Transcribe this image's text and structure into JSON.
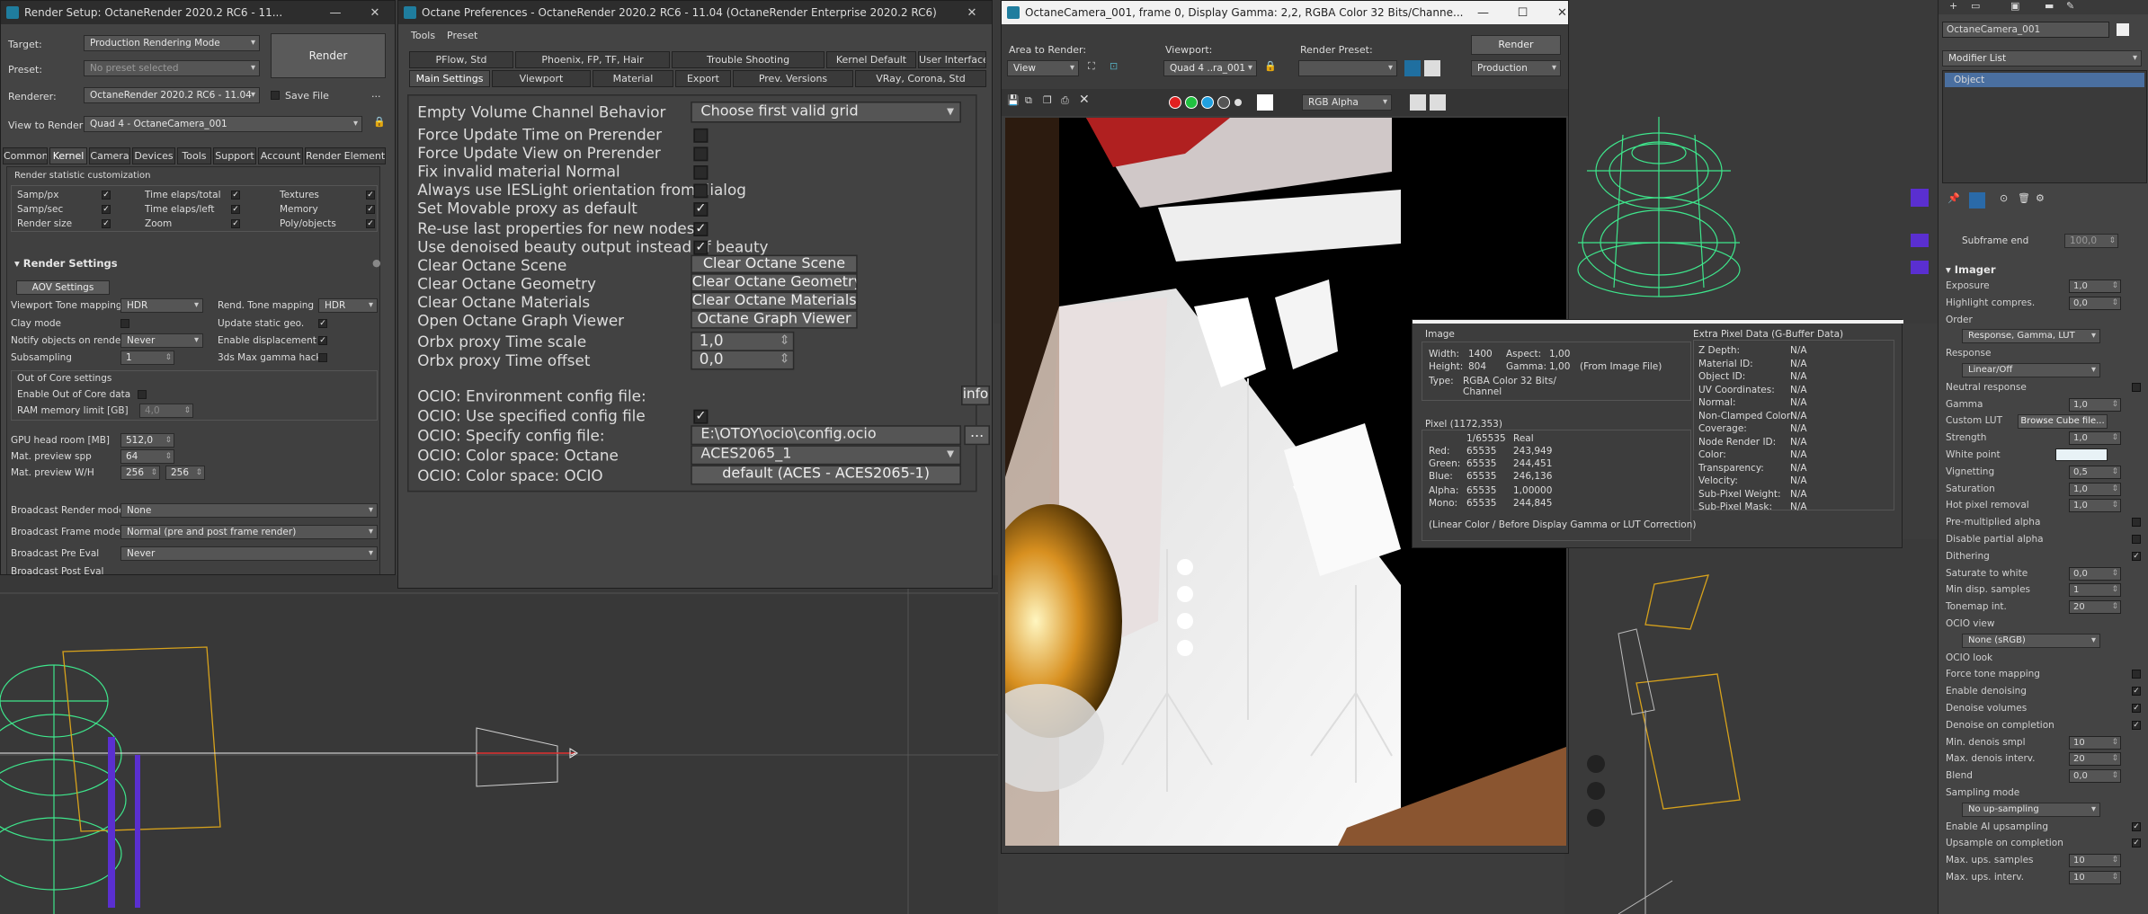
{
  "render_setup": {
    "title": "Render Setup: OctaneRender 2020.2 RC6 - 11...",
    "target_label": "Target:",
    "target_value": "Production Rendering Mode",
    "preset_label": "Preset:",
    "preset_value": "No preset selected",
    "renderer_label": "Renderer:",
    "renderer_value": "OctaneRender 2020.2 RC6 - 11.04",
    "save_file": "Save File",
    "view_label": "View to Render:",
    "view_value": "Quad 4 - OctaneCamera_001",
    "render_button": "Render",
    "tabs": [
      "Common",
      "Kernel",
      "Camera",
      "Devices",
      "Tools",
      "Support",
      "Account",
      "Render Elements"
    ],
    "stats_header": "Render statistic customization",
    "stats": [
      [
        "Samp/px",
        "Time elaps/total",
        "Textures"
      ],
      [
        "Samp/sec",
        "Time elaps/left",
        "Memory"
      ],
      [
        "Render size",
        "Zoom",
        "Poly/objects"
      ]
    ],
    "settings_header": "Render Settings",
    "aov_button": "AOV Settings",
    "vp_tone_label": "Viewport Tone mapping",
    "vp_tone_value": "HDR",
    "rend_tone_label": "Rend. Tone mapping",
    "rend_tone_value": "HDR",
    "clay_label": "Clay mode",
    "update_static_label": "Update static geo.",
    "notify_label": "Notify objects on render",
    "notify_value": "Never",
    "enable_disp_label": "Enable displacement",
    "subsampling_label": "Subsampling",
    "subsampling_value": "1",
    "gamma_hack_label": "3ds Max gamma hack",
    "out_of_core_header": "Out of Core settings",
    "enable_ooc_label": "Enable Out of Core data",
    "ram_limit_label": "RAM memory limit [GB]",
    "ram_limit_value": "4,0",
    "gpu_headroom_label": "GPU head room [MB]",
    "gpu_headroom_value": "512,0",
    "mat_spp_label": "Mat. preview spp",
    "mat_spp_value": "64",
    "mat_wh_label": "Mat. preview W/H",
    "mat_w_value": "256",
    "mat_h_value": "256",
    "bcast_render_label": "Broadcast Render mode",
    "bcast_render_value": "None",
    "bcast_frame_label": "Broadcast Frame mode",
    "bcast_frame_value": "Normal (pre and post frame render)",
    "bcast_pre_label": "Broadcast Pre Eval",
    "bcast_pre_value": "Never",
    "bcast_more_label": "Broadcast Post Eval"
  },
  "prefs": {
    "title": "Octane Preferences - OctaneRender 2020.2 RC6 - 11.04 (OctaneRender Enterprise 2020.2 RC6)",
    "menu": [
      "Tools",
      "Preset"
    ],
    "tabs_row1": [
      "PFlow, Std",
      "Phoenix, FP, TF, Hair",
      "Trouble Shooting",
      "Kernel Default",
      "User Interface"
    ],
    "tabs_row2": [
      "Main Settings",
      "Viewport",
      "Material",
      "Export",
      "Prev. Versions",
      "VRay, Corona, Std"
    ],
    "rows": [
      {
        "label": "Empty Volume Channel Behavior",
        "type": "drop",
        "value": "Choose first valid grid"
      },
      {
        "label": "Force Update Time on Prerender",
        "type": "chk",
        "value": ""
      },
      {
        "label": "Force Update View on Prerender",
        "type": "chk",
        "value": ""
      },
      {
        "label": "Fix invalid material Normal",
        "type": "chk",
        "value": ""
      },
      {
        "label": "Always use IESLight orientation from dialog",
        "type": "chk",
        "value": ""
      },
      {
        "label": "Set Movable proxy as default",
        "type": "chk",
        "value": "✓"
      },
      {
        "label": "Re-use last properties for new nodes",
        "type": "chk",
        "value": "✓"
      },
      {
        "label": "Use denoised beauty output instead of beauty",
        "type": "chk",
        "value": "✓"
      },
      {
        "label": "Clear Octane Scene",
        "type": "btn",
        "value": "Clear Octane Scene"
      },
      {
        "label": "Clear Octane Geometry",
        "type": "btn",
        "value": "Clear Octane Geometry"
      },
      {
        "label": "Clear Octane Materials",
        "type": "btn",
        "value": "Clear Octane Materials"
      },
      {
        "label": "Open Octane Graph Viewer",
        "type": "btn",
        "value": "Octane Graph Viewer"
      },
      {
        "label": "Orbx proxy Time scale",
        "type": "spin",
        "value": "1,0"
      },
      {
        "label": "Orbx proxy Time offset",
        "type": "spin",
        "value": "0,0"
      }
    ],
    "ocio_env_label": "OCIO: Environment config file:",
    "info_btn": "info",
    "ocio_use_label": "OCIO: Use specified config file",
    "ocio_spec_label": "OCIO: Specify config file:",
    "ocio_spec_value": "E:\\OTOY\\ocio\\config.ocio",
    "browse_btn": "...",
    "ocio_cs_octane_label": "OCIO: Color space: Octane",
    "ocio_cs_octane_value": "ACES2065_1",
    "ocio_cs_ocio_label": "OCIO: Color space: OCIO",
    "ocio_cs_ocio_value": "default (ACES - ACES2065-1)"
  },
  "camera_win": {
    "title": "OctaneCamera_001, frame 0, Display Gamma: 2,2, RGBA Color 32 Bits/Channe...",
    "area_label": "Area to Render:",
    "area_value": "View",
    "viewport_label": "Viewport:",
    "viewport_value": "Quad 4 ..ra_001",
    "preset_label": "Render Preset:",
    "preset_value": "",
    "render_btn": "Render",
    "production_value": "Production",
    "channel_value": "RGB Alpha"
  },
  "pixel_info": {
    "image_header": "Image",
    "width_label": "Width:",
    "width_value": "1400",
    "aspect_label": "Aspect:",
    "aspect_value": "1,00",
    "height_label": "Height:",
    "height_value": "804",
    "gamma_label": "Gamma:",
    "gamma_value": "1,00",
    "gamma_note": "(From Image File)",
    "type_label": "Type:",
    "type_value": "RGBA Color 32 Bits/ Channel",
    "pixel_header": "Pixel (1172,353)",
    "col_int": "1/65535",
    "col_real": "Real",
    "channels": [
      {
        "name": "Red:",
        "int": "65535",
        "real": "243,949"
      },
      {
        "name": "Green:",
        "int": "65535",
        "real": "244,451"
      },
      {
        "name": "Blue:",
        "int": "65535",
        "real": "246,136"
      },
      {
        "name": "Alpha:",
        "int": "65535",
        "real": "1,00000"
      },
      {
        "name": "Mono:",
        "int": "65535",
        "real": "244,845"
      }
    ],
    "note": "(Linear Color / Before Display Gamma or LUT Correction)",
    "extra_header": "Extra Pixel Data (G-Buffer Data)",
    "extra": [
      [
        "Z Depth:",
        "N/A"
      ],
      [
        "Material ID:",
        "N/A"
      ],
      [
        "Object ID:",
        "N/A"
      ],
      [
        "UV Coordinates:",
        "N/A"
      ],
      [
        "Normal:",
        "N/A"
      ],
      [
        "Non-Clamped Color:",
        "N/A"
      ],
      [
        "Coverage:",
        "N/A"
      ],
      [
        "Node Render ID:",
        "N/A"
      ],
      [
        "Color:",
        "N/A"
      ],
      [
        "Transparency:",
        "N/A"
      ],
      [
        "Velocity:",
        "N/A"
      ],
      [
        "Sub-Pixel Weight:",
        "N/A"
      ],
      [
        "Sub-Pixel Mask:",
        "N/A"
      ]
    ]
  },
  "right_panel": {
    "object_name": "OctaneCamera_001",
    "modifier_list": "Modifier List",
    "stack_item": "Object",
    "subframe_label": "Subframe end",
    "subframe_value": "100,0",
    "imager_header": "Imager",
    "rows": [
      {
        "label": "Exposure",
        "type": "spin",
        "value": "1,0"
      },
      {
        "label": "Highlight compres.",
        "type": "spin",
        "value": "0,0"
      },
      {
        "label": "Order",
        "type": "head",
        "value": ""
      },
      {
        "label": "",
        "type": "drop",
        "value": "Response, Gamma, LUT"
      },
      {
        "label": "Response",
        "type": "head",
        "value": ""
      },
      {
        "label": "",
        "type": "drop",
        "value": "Linear/Off"
      },
      {
        "label": "Neutral response",
        "type": "chk",
        "value": ""
      },
      {
        "label": "Gamma",
        "type": "spin",
        "value": "1,0"
      },
      {
        "label": "Custom LUT",
        "type": "btn",
        "value": "Browse Cube file..."
      },
      {
        "label": "Strength",
        "type": "spin",
        "value": "1,0"
      },
      {
        "label": "White point",
        "type": "swatch",
        "value": ""
      },
      {
        "label": "Vignetting",
        "type": "spin",
        "value": "0,5"
      },
      {
        "label": "Saturation",
        "type": "spin",
        "value": "1,0"
      },
      {
        "label": "Hot pixel removal",
        "type": "spin",
        "value": "1,0"
      },
      {
        "label": "Pre-multiplied alpha",
        "type": "chk",
        "value": ""
      },
      {
        "label": "Disable partial alpha",
        "type": "chk",
        "value": ""
      },
      {
        "label": "Dithering",
        "type": "chk",
        "value": "✓"
      },
      {
        "label": "Saturate to white",
        "type": "spin",
        "value": "0,0"
      },
      {
        "label": "Min disp. samples",
        "type": "spin",
        "value": "1"
      },
      {
        "label": "Tonemap int.",
        "type": "spin",
        "value": "20"
      },
      {
        "label": "OCIO view",
        "type": "head",
        "value": ""
      },
      {
        "label": "",
        "type": "drop",
        "value": "None (sRGB)"
      },
      {
        "label": "OCIO look",
        "type": "head",
        "value": ""
      },
      {
        "label": "Force tone mapping",
        "type": "chk",
        "value": ""
      },
      {
        "label": "Enable denoising",
        "type": "chk",
        "value": "✓"
      },
      {
        "label": "Denoise volumes",
        "type": "chk",
        "value": "✓"
      },
      {
        "label": "Denoise on completion",
        "type": "chk",
        "value": "✓"
      },
      {
        "label": "Min. denois smpl",
        "type": "spin",
        "value": "10"
      },
      {
        "label": "Max. denois interv.",
        "type": "spin",
        "value": "20"
      },
      {
        "label": "Blend",
        "type": "spin",
        "value": "0,0"
      },
      {
        "label": "Sampling mode",
        "type": "head",
        "value": ""
      },
      {
        "label": "",
        "type": "drop",
        "value": "No up-sampling"
      },
      {
        "label": "Enable AI upsampling",
        "type": "chk",
        "value": "✓"
      },
      {
        "label": "Upsample on completion",
        "type": "chk",
        "value": "✓"
      },
      {
        "label": "Max. ups. samples",
        "type": "spin",
        "value": "10"
      },
      {
        "label": "Max. ups. interv.",
        "type": "spin",
        "value": "10"
      }
    ]
  },
  "colors": {
    "accent": "#1f7d9e",
    "wire_green": "#3ee68c",
    "wire_purple": "#5a2fd0",
    "frame_yellow": "#d7a21c"
  }
}
